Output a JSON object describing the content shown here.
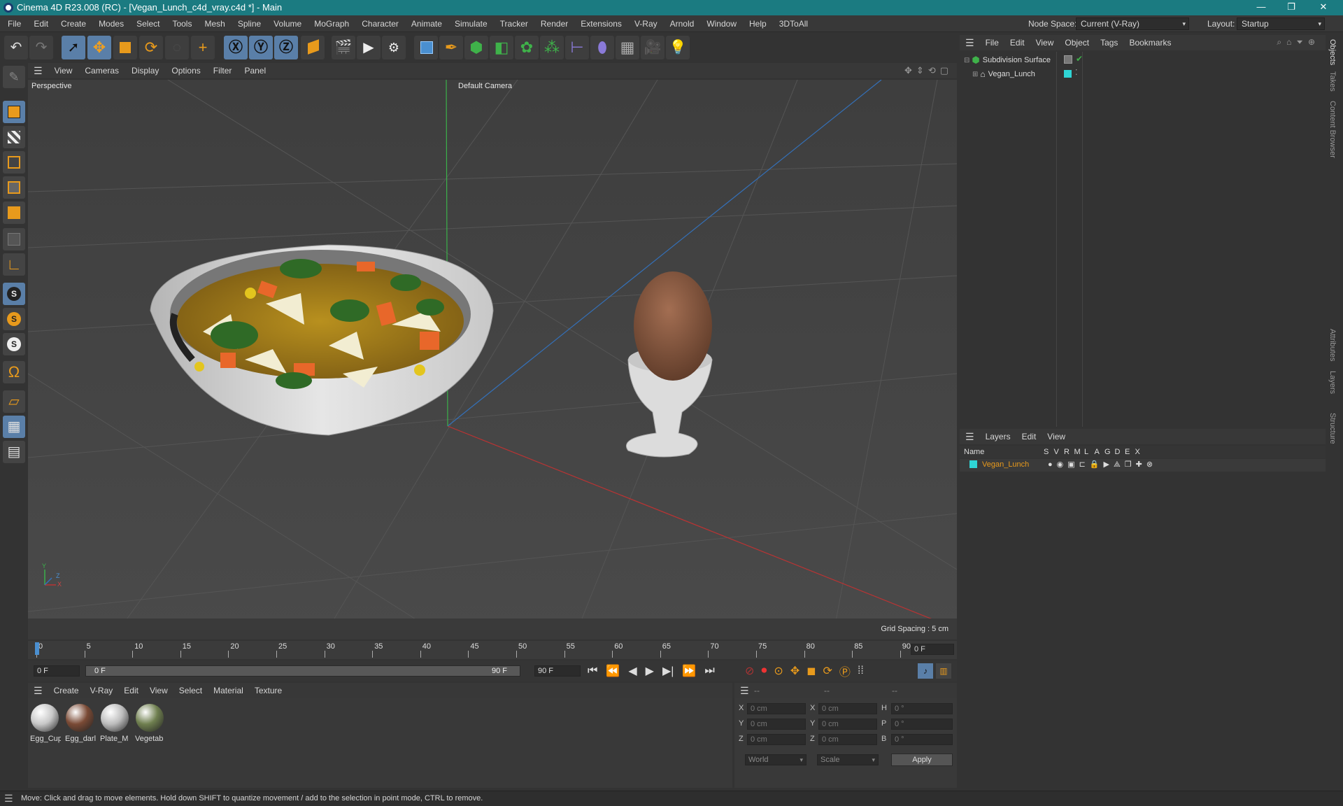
{
  "window": {
    "title": "Cinema 4D R23.008 (RC) - [Vegan_Lunch_c4d_vray.c4d *] - Main",
    "minimize": "—",
    "restore": "❐",
    "close": "✕"
  },
  "menubar": {
    "items": [
      "File",
      "Edit",
      "Create",
      "Modes",
      "Select",
      "Tools",
      "Mesh",
      "Spline",
      "Volume",
      "MoGraph",
      "Character",
      "Animate",
      "Simulate",
      "Tracker",
      "Render",
      "Extensions",
      "V-Ray",
      "Arnold",
      "Window",
      "Help",
      "3DToAll"
    ],
    "node_space_label": "Node Space:",
    "node_space_value": "Current (V-Ray)",
    "layout_label": "Layout:",
    "layout_value": "Startup"
  },
  "viewport": {
    "menu": [
      "View",
      "Cameras",
      "Display",
      "Options",
      "Filter",
      "Panel"
    ],
    "view_name": "Perspective",
    "camera": "Default Camera",
    "grid_spacing": "Grid Spacing : 5 cm",
    "axis_y": "Y",
    "axis_x": "X",
    "axis_z": "Z"
  },
  "objects_panel": {
    "menu": [
      "File",
      "Edit",
      "View",
      "Object",
      "Tags",
      "Bookmarks"
    ],
    "items": [
      {
        "name": "Subdivision Surface"
      },
      {
        "name": "Vegan_Lunch"
      }
    ]
  },
  "layers_panel": {
    "menu": [
      "Layers",
      "Edit",
      "View"
    ],
    "columns": [
      "Name",
      "S",
      "V",
      "R",
      "M",
      "L",
      "A",
      "G",
      "D",
      "E",
      "X"
    ],
    "rows": [
      {
        "name": "Vegan_Lunch"
      }
    ]
  },
  "right_tabs": [
    "Objects",
    "Takes",
    "Content Browser",
    "Attributes",
    "Layers",
    "Structure"
  ],
  "timeline": {
    "ticks": [
      "0",
      "5",
      "10",
      "15",
      "20",
      "25",
      "30",
      "35",
      "40",
      "45",
      "50",
      "55",
      "60",
      "65",
      "70",
      "75",
      "80",
      "85",
      "90"
    ],
    "current_frame_right": "0 F",
    "start_field": "0 F",
    "range_start": "0 F",
    "range_end": "90 F",
    "end_field": "90 F"
  },
  "materials": {
    "menu": [
      "Create",
      "V-Ray",
      "Edit",
      "View",
      "Select",
      "Material",
      "Texture"
    ],
    "items": [
      {
        "label": "Egg_Cup",
        "color": "#c8c8c8"
      },
      {
        "label": "Egg_darl",
        "color": "#7a4a35"
      },
      {
        "label": "Plate_M",
        "color": "#bdbdbd"
      },
      {
        "label": "Vegetab",
        "color": "#6f7f4f"
      }
    ]
  },
  "coordinates": {
    "headers": [
      "--",
      "--",
      "--"
    ],
    "rows": [
      {
        "a_label": "X",
        "a_val": "0 cm",
        "b_label": "X",
        "b_val": "0 cm",
        "c_label": "H",
        "c_val": "0 °"
      },
      {
        "a_label": "Y",
        "a_val": "0 cm",
        "b_label": "Y",
        "b_val": "0 cm",
        "c_label": "P",
        "c_val": "0 °"
      },
      {
        "a_label": "Z",
        "a_val": "0 cm",
        "b_label": "Z",
        "b_val": "0 cm",
        "c_label": "B",
        "c_val": "0 °"
      }
    ],
    "space": "World",
    "mode": "Scale",
    "apply": "Apply"
  },
  "status": "Move: Click and drag to move elements. Hold down SHIFT to quantize movement / add to the selection in point mode, CTRL to remove.",
  "colors": {
    "titlebar": "#1b7b81",
    "accent_blue": "#4a8fd0",
    "accent_orange": "#e89a1c",
    "layer_cyan": "#2fd4d4"
  }
}
